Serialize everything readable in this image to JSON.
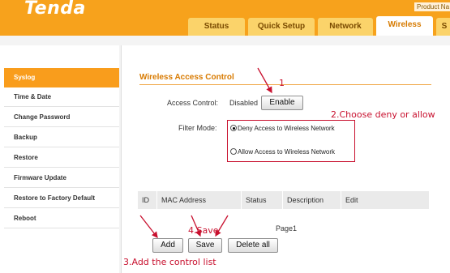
{
  "brand": {
    "logo": "Tenda",
    "product_text": "Product Na"
  },
  "tabs": [
    {
      "label": "Status"
    },
    {
      "label": "Quick Setup"
    },
    {
      "label": "Network"
    },
    {
      "label": "Wireless"
    },
    {
      "label": "S"
    }
  ],
  "sidebar": {
    "items": [
      {
        "label": "Syslog"
      },
      {
        "label": "Time & Date"
      },
      {
        "label": "Change Password"
      },
      {
        "label": "Backup"
      },
      {
        "label": "Restore"
      },
      {
        "label": "Firmware Update"
      },
      {
        "label": "Restore to Factory Default"
      },
      {
        "label": "Reboot"
      }
    ]
  },
  "main": {
    "title": "Wireless Access Control",
    "access_control_label": "Access Control:",
    "access_control_value": "Disabled",
    "enable_button": "Enable",
    "filter_mode_label": "Filter Mode:",
    "filter_options": [
      {
        "label": "Deny Access to Wireless Network",
        "selected": true
      },
      {
        "label": "Allow Access to Wireless Network",
        "selected": false
      }
    ],
    "table_headers": [
      "ID",
      "MAC Address",
      "Status",
      "Description",
      "Edit"
    ],
    "page_label": "Page1",
    "buttons": {
      "add": "Add",
      "save": "Save",
      "delete_all": "Delete all"
    }
  },
  "annotations": {
    "step1": "1",
    "step2": "2.Choose deny or allow",
    "step3": "3.Add the control list",
    "step4": "4.Save"
  },
  "colors": {
    "brand_orange": "#f7a21c",
    "annotation_red": "#c8102e",
    "title_orange": "#d87a00"
  }
}
